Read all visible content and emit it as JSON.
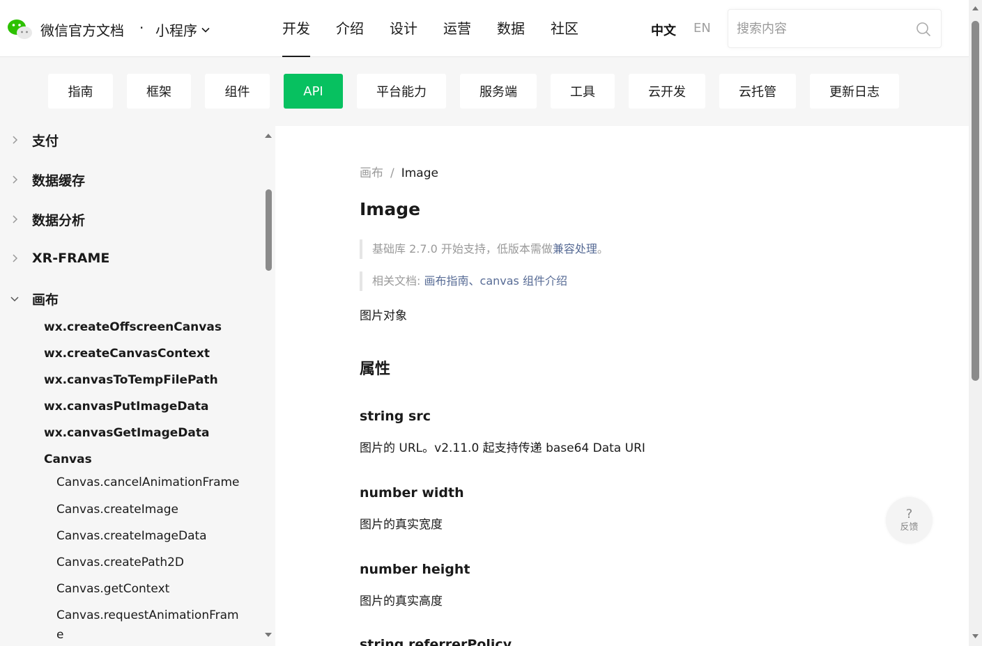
{
  "header": {
    "brand": "微信官方文档",
    "dot": "·",
    "sub": "小程序",
    "nav": [
      "开发",
      "介绍",
      "设计",
      "运营",
      "数据",
      "社区"
    ],
    "lang_zh": "中文",
    "lang_en": "EN",
    "search_placeholder": "搜索内容"
  },
  "subnav": [
    "指南",
    "框架",
    "组件",
    "API",
    "平台能力",
    "服务端",
    "工具",
    "云开发",
    "云托管",
    "更新日志"
  ],
  "sidebar": {
    "level1": [
      "支付",
      "数据缓存",
      "数据分析",
      "XR-FRAME",
      "画布"
    ],
    "level2": [
      "wx.createOffscreenCanvas",
      "wx.createCanvasContext",
      "wx.canvasToTempFilePath",
      "wx.canvasPutImageData",
      "wx.canvasGetImageData",
      "Canvas"
    ],
    "level3": [
      "Canvas.cancelAnimationFrame",
      "Canvas.createImage",
      "Canvas.createImageData",
      "Canvas.createPath2D",
      "Canvas.getContext",
      "Canvas.requestAnimationFram",
      "e"
    ]
  },
  "content": {
    "crumb_parent": "画布",
    "crumb_sep": "/",
    "crumb_current": "Image",
    "title": "Image",
    "note1_text": "基础库 2.7.0 开始支持，低版本需做",
    "note1_link": "兼容处理",
    "note1_end": "。",
    "note2_label": "相关文档: ",
    "note2_link1": "画布指南",
    "note2_sep": "、",
    "note2_link2": "canvas 组件介绍",
    "desc": "图片对象",
    "section": "属性",
    "props": [
      {
        "name": "string src",
        "desc": "图片的 URL。v2.11.0 起支持传递 base64 Data URI"
      },
      {
        "name": "number width",
        "desc": "图片的真实宽度"
      },
      {
        "name": "number height",
        "desc": "图片的真实高度"
      },
      {
        "name": "string referrerPolicy",
        "desc": ""
      }
    ]
  },
  "feedback": {
    "q": "?",
    "label": "反馈"
  },
  "colors": {
    "accent": "#07c160",
    "link": "#576b95",
    "muted": "#9a9a9a"
  }
}
